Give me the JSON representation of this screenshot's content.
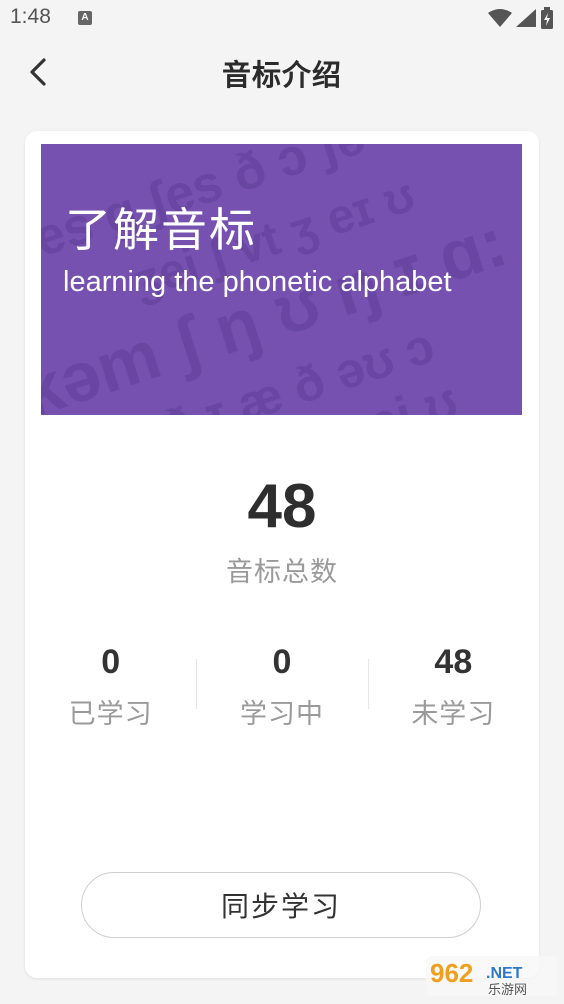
{
  "status_bar": {
    "time": "1:48",
    "notification_icon": "A"
  },
  "header": {
    "title": "音标介绍"
  },
  "banner": {
    "title": "了解音标",
    "subtitle": "learning the phonetic alphabet",
    "background_text": [
      "ɑ:es ɡ ʃes ð ɔ ʃə ɔ ʊ",
      "ʒei ʃ vt ʒ eɪ ʊ",
      "kəm ʃ ŋ ʊ ŋ ɪ ɑ:",
      "ɪv ð ɪ æ ð əʊ ɔ",
      "ʃ ʒei ʊ"
    ],
    "color": "#7651b0"
  },
  "summary": {
    "total_value": "48",
    "total_label": "音标总数"
  },
  "stats": [
    {
      "value": "0",
      "label": "已学习"
    },
    {
      "value": "0",
      "label": "学习中"
    },
    {
      "value": "48",
      "label": "未学习"
    }
  ],
  "sync_button": {
    "label": "同步学习"
  },
  "watermark": {
    "text": "962",
    "suffix": ".NET",
    "subtext": "乐游网"
  }
}
